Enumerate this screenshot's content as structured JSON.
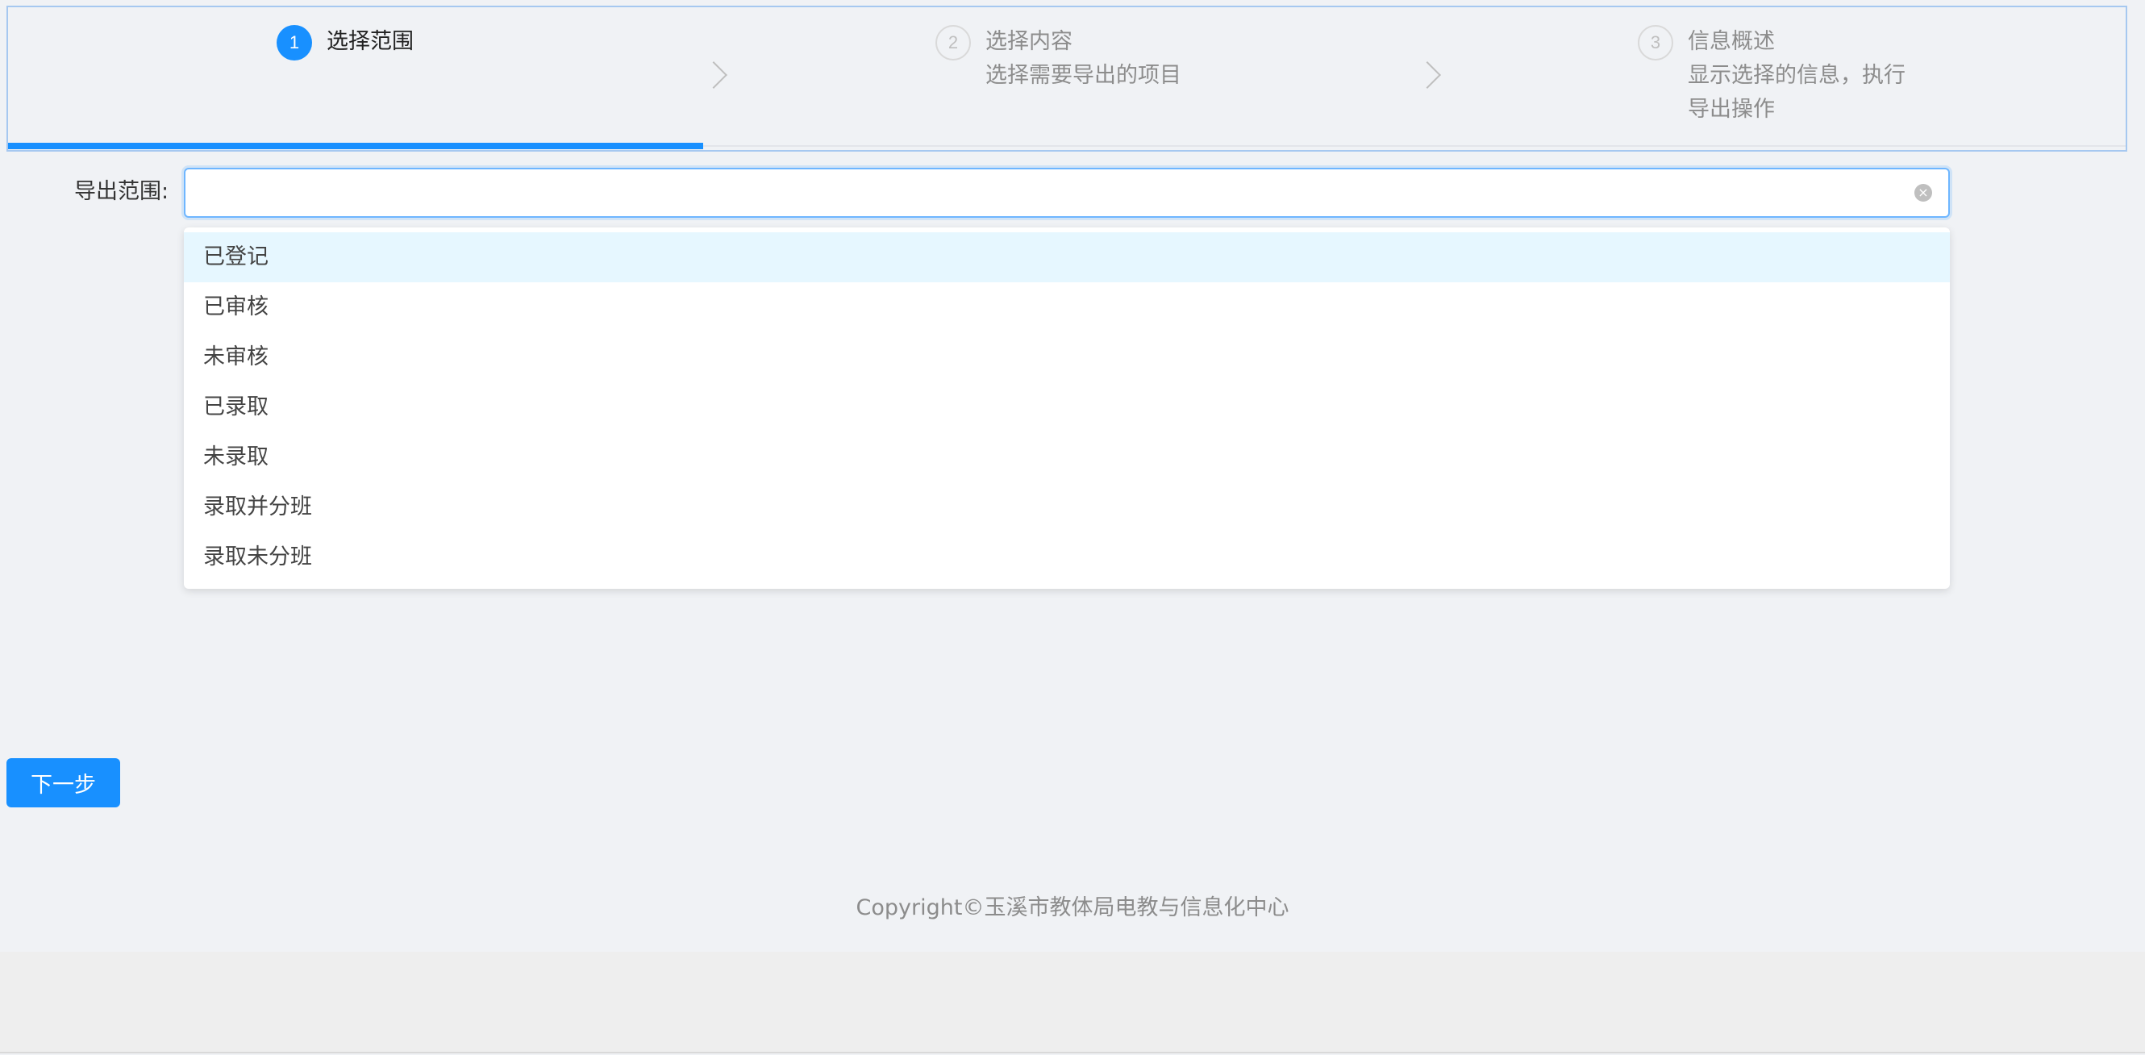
{
  "steps": [
    {
      "number": "1",
      "title": "选择范围",
      "description": ""
    },
    {
      "number": "2",
      "title": "选择内容",
      "description": "选择需要导出的项目"
    },
    {
      "number": "3",
      "title": "信息概述",
      "description_line1": "显示选择的信息，执行",
      "description_line2": "导出操作"
    }
  ],
  "form": {
    "range_label": "导出范围:",
    "range_value": "",
    "options": [
      "已登记",
      "已审核",
      "未审核",
      "已录取",
      "未录取",
      "录取并分班",
      "录取未分班"
    ],
    "highlighted_option": "已登记"
  },
  "actions": {
    "next_label": "下一步"
  },
  "footer": {
    "copyright": "Copyright©玉溪市教体局电教与信息化中心"
  },
  "colors": {
    "primary": "#1890ff",
    "highlight_bg": "#e6f7ff",
    "background": "#f0f2f5"
  }
}
